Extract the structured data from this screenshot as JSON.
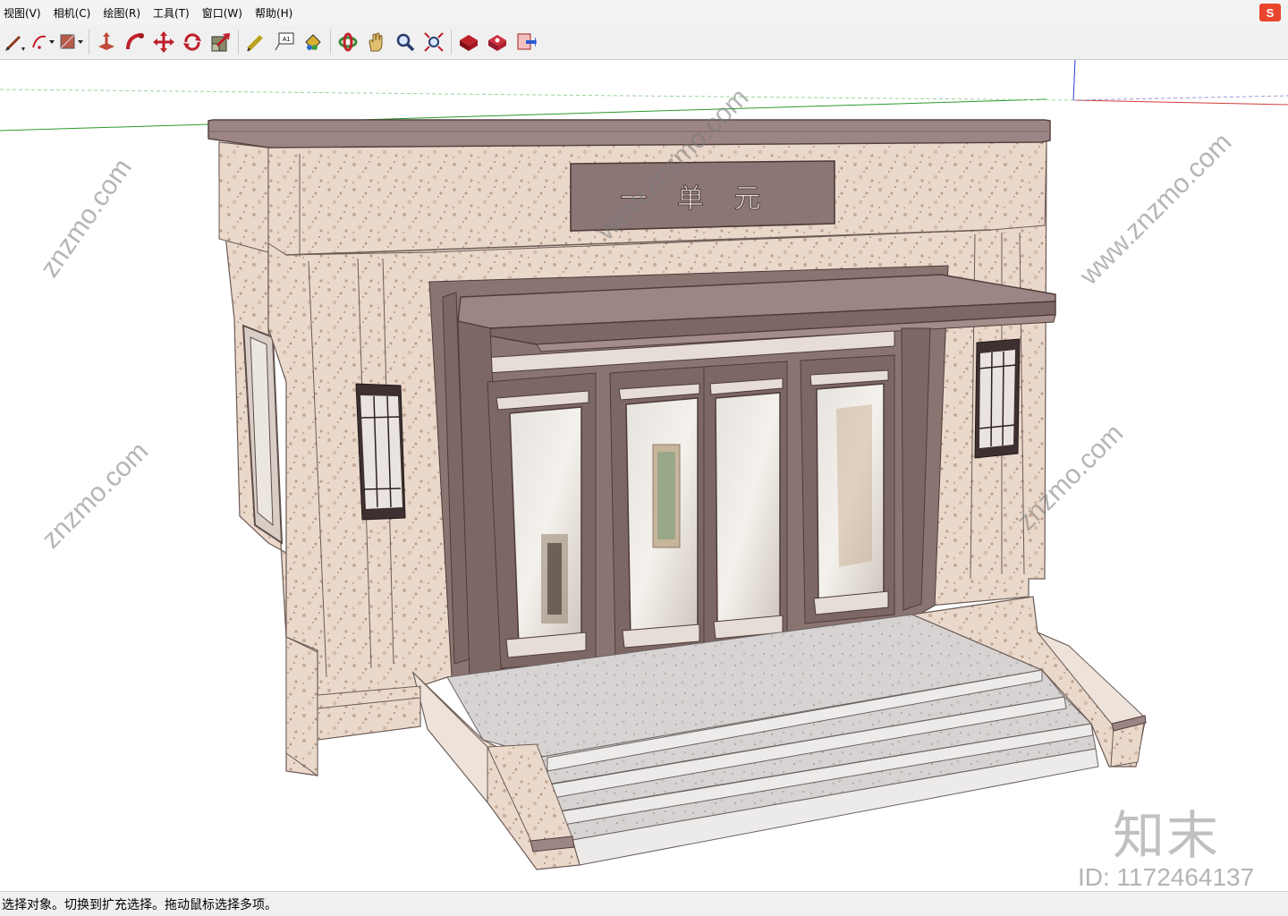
{
  "menu": {
    "items": [
      "视图(V)",
      "相机(C)",
      "绘图(R)",
      "工具(T)",
      "窗口(W)",
      "帮助(H)"
    ]
  },
  "toolbar": {
    "tools": [
      "pencil-tool-icon",
      "arc-tool-icon",
      "rectangle-tool-icon",
      "push-pull-icon",
      "follow-me-icon",
      "move-icon",
      "rotate-icon",
      "scale-icon",
      "tape-measure-icon",
      "text-icon",
      "paint-bucket-icon",
      "orbit-icon",
      "pan-icon",
      "zoom-icon",
      "zoom-extents-icon",
      "warehouse-icon",
      "extension-warehouse-icon",
      "send-to-layout-icon"
    ]
  },
  "model": {
    "sign_text": "一 单 元"
  },
  "watermark": {
    "brand": "知末",
    "id_text": "ID: 1172464137"
  },
  "status": {
    "text": "选择对象。切换到扩充选择。拖动鼠标选择多项。"
  },
  "colors": {
    "accent": "#e8452c",
    "frame": "#6e5a56",
    "axis_red": "#d23c3c",
    "axis_green": "#2a9a2a",
    "axis_blue": "#2a3cd2"
  }
}
